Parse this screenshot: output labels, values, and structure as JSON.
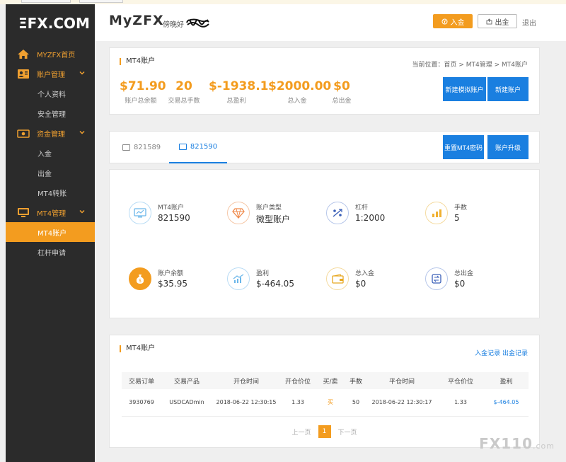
{
  "sidebar": {
    "logo": "ΞFX.COM",
    "home": "MYZFX首页",
    "account_mgmt": "账户管理",
    "personal_info": "个人资料",
    "security": "安全管理",
    "funds_mgmt": "资金管理",
    "deposit": "入金",
    "withdraw": "出金",
    "mt4_transfer": "MT4转账",
    "mt4_mgmt": "MT4管理",
    "mt4_account": "MT4账户",
    "leverage_apply": "杠杆申请"
  },
  "header": {
    "brand": "MyZFX",
    "greeting": "傍晚好",
    "deposit_btn": "入金",
    "withdraw_btn": "出金",
    "logout": "退出"
  },
  "summary": {
    "title": "MT4账户",
    "breadcrumb": "当前位置：首页 > MT4管理 > MT4账户",
    "stats": [
      {
        "value": "$71.90",
        "label": "账户总余额"
      },
      {
        "value": "20",
        "label": "交易总手数"
      },
      {
        "value": "$-1938.1",
        "label": "总盈利"
      },
      {
        "value": "$2000.00",
        "label": "总入金"
      },
      {
        "value": "$0",
        "label": "总出金"
      }
    ],
    "btn_demo": "新建模拟账户",
    "btn_new": "新建账户"
  },
  "tabs": {
    "tab1": "821589",
    "tab2": "821590",
    "btn_reset": "重置MT4密码",
    "btn_upgrade": "账户升级"
  },
  "info": [
    {
      "label": "MT4账户",
      "value": "821590",
      "icon": "monitor-icon"
    },
    {
      "label": "账户类型",
      "value": "微型账户",
      "icon": "diamond-icon"
    },
    {
      "label": "杠杆",
      "value": "1:2000",
      "icon": "leverage-icon"
    },
    {
      "label": "手数",
      "value": "5",
      "icon": "bar-chart-icon"
    },
    {
      "label": "账户余额",
      "value": "$35.95",
      "icon": "money-bag-icon"
    },
    {
      "label": "盈利",
      "value": "$-464.05",
      "icon": "trend-icon"
    },
    {
      "label": "总入金",
      "value": "$0",
      "icon": "wallet-icon"
    },
    {
      "label": "总出金",
      "value": "$0",
      "icon": "transfer-icon"
    }
  ],
  "orders": {
    "title": "MT4账户",
    "link_deposit": "入金记录",
    "link_withdraw": "出金记录",
    "columns": [
      "交易订单",
      "交易产品",
      "开仓时间",
      "开仓价位",
      "买/卖",
      "手数",
      "平仓时间",
      "平仓价位",
      "盈利"
    ],
    "rows": [
      [
        "3930769",
        "USDCADmin",
        "2018-06-22 12:30:15",
        "1.33",
        "买",
        "50",
        "2018-06-22 12:30:17",
        "1.33",
        "$-464.05"
      ]
    ],
    "prev": "上一页",
    "page": "1",
    "next": "下一页"
  },
  "watermark": {
    "main": "FX110",
    "suffix": ".com"
  },
  "colors": {
    "accent": "#f39c1f",
    "blue": "#1a7fe0",
    "sidebar": "#2b2b2b"
  }
}
